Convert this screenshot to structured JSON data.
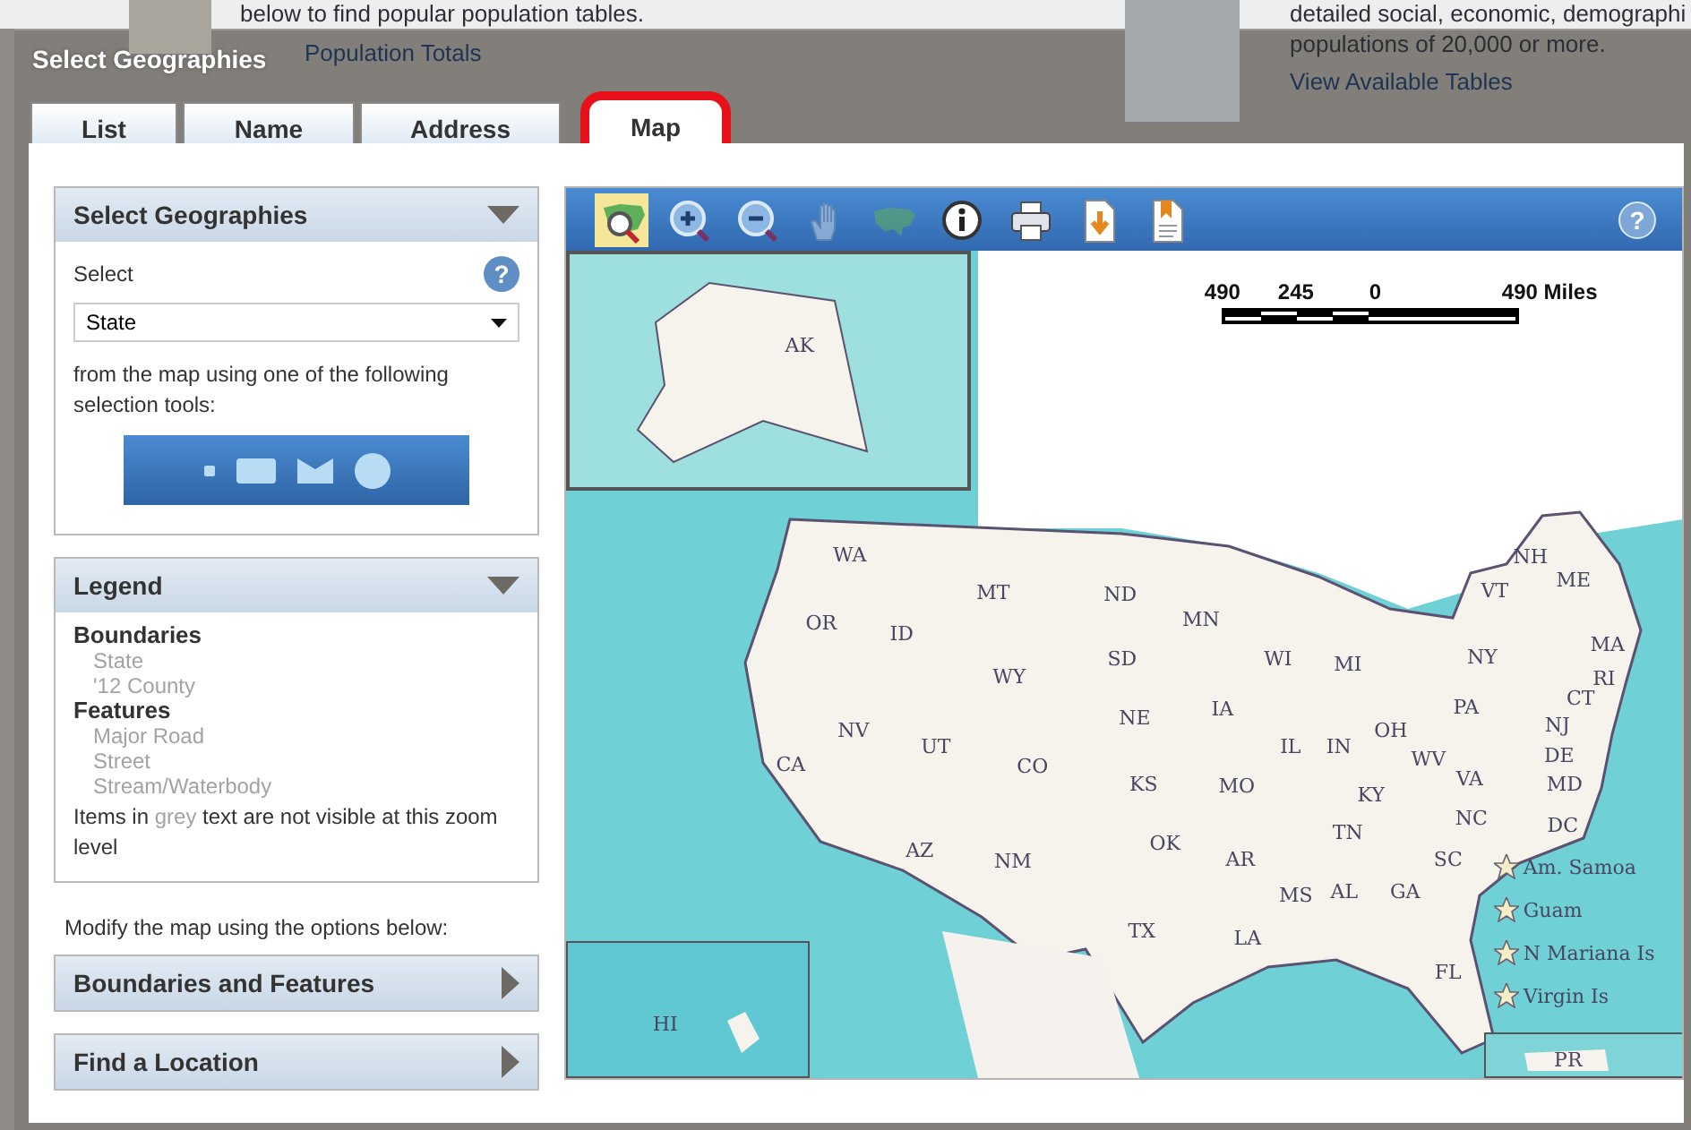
{
  "background_page": {
    "left_text": "below to find popular population tables.",
    "left_link": "Population Totals",
    "right_text": "detailed social, economic, demographi",
    "right_note": "populations of 20,000 or more.",
    "right_link": "View Available Tables"
  },
  "dialog": {
    "title": "Select Geographies"
  },
  "tabs": [
    {
      "label": "List",
      "selected": false,
      "circled": false
    },
    {
      "label": "Name",
      "selected": false,
      "circled": false
    },
    {
      "label": "Address",
      "selected": false,
      "circled": false
    },
    {
      "label": "Map",
      "selected": true,
      "circled": true
    }
  ],
  "select_panel": {
    "title": "Select Geographies",
    "expanded": true,
    "label": "Select",
    "help_glyph": "?",
    "dropdown": {
      "value": "State"
    },
    "instruction": "from the map using one of the following selection tools:"
  },
  "selection_tools": [
    {
      "kind": "point"
    },
    {
      "kind": "rectangle"
    },
    {
      "kind": "polygon"
    },
    {
      "kind": "circle"
    }
  ],
  "legend": {
    "title": "Legend",
    "expanded": true,
    "groups": [
      {
        "name": "Boundaries",
        "items": [
          {
            "label": "State",
            "visible": false
          },
          {
            "label": "'12 County",
            "visible": false
          }
        ]
      },
      {
        "name": "Features",
        "items": [
          {
            "label": "Major Road",
            "visible": false
          },
          {
            "label": "Street",
            "visible": false
          },
          {
            "label": "Stream/Waterbody",
            "visible": false
          }
        ]
      }
    ],
    "note_before": "Items in",
    "note_grey": "grey",
    "note_after": "text are not visible at this zoom level"
  },
  "modify_hint": "Modify the map using the options below:",
  "sections": [
    {
      "title": "Boundaries and Features",
      "expanded": false
    },
    {
      "title": "Find a Location",
      "expanded": false
    }
  ],
  "map": {
    "toolbar": [
      {
        "kind": "select-map",
        "selected": true,
        "disabled": false
      },
      {
        "kind": "zoom-in",
        "selected": false,
        "disabled": false
      },
      {
        "kind": "zoom-out",
        "selected": false,
        "disabled": false
      },
      {
        "kind": "pan",
        "selected": false,
        "disabled": true
      },
      {
        "kind": "full-extent",
        "selected": false,
        "disabled": true
      },
      {
        "kind": "info",
        "selected": false,
        "disabled": false
      },
      {
        "kind": "print",
        "selected": false,
        "disabled": false
      },
      {
        "kind": "download",
        "selected": false,
        "disabled": false
      },
      {
        "kind": "bookmark",
        "selected": false,
        "disabled": false
      },
      {
        "kind": "help",
        "selected": false,
        "disabled": false
      }
    ],
    "help_glyph": "?",
    "scale_labels": [
      "490",
      "245",
      "0",
      "490 Miles"
    ],
    "inset_labels": [
      "AK",
      "HI",
      "PR"
    ],
    "state_labels": [
      "WA",
      "OR",
      "ID",
      "MT",
      "ND",
      "MN",
      "WY",
      "SD",
      "WI",
      "MI",
      "NY",
      "VT",
      "NH",
      "ME",
      "MA",
      "RI",
      "CT",
      "NJ",
      "DE",
      "MD",
      "DC",
      "PA",
      "OH",
      "IL",
      "IN",
      "IA",
      "NE",
      "CA",
      "NV",
      "UT",
      "CO",
      "KS",
      "MO",
      "KY",
      "WV",
      "VA",
      "NC",
      "TN",
      "AZ",
      "NM",
      "OK",
      "AR",
      "SC",
      "MS",
      "AL",
      "GA",
      "TX",
      "LA",
      "FL"
    ],
    "territories": [
      "Am. Samoa",
      "Guam",
      "N Mariana Is",
      "Virgin Is"
    ]
  }
}
